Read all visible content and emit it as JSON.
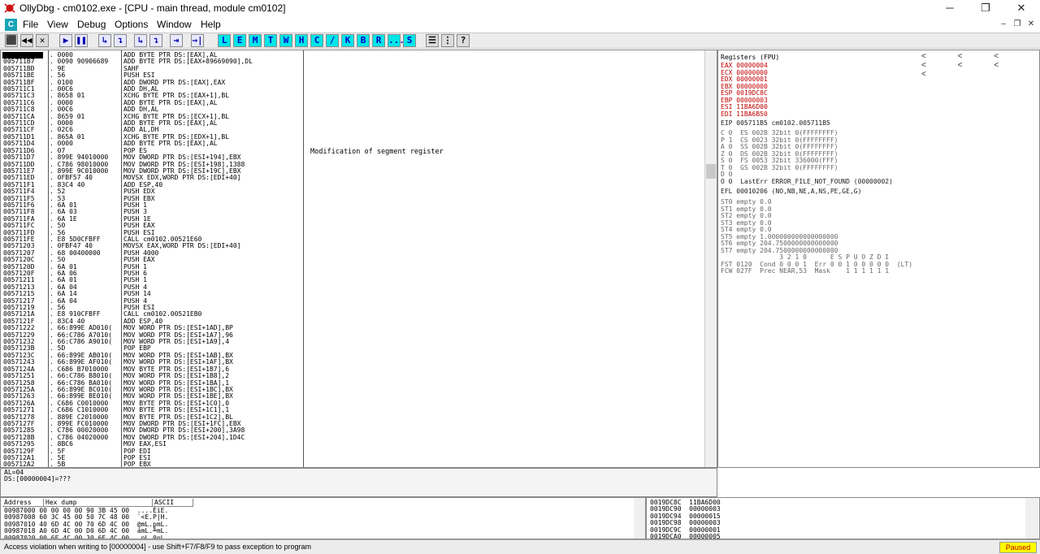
{
  "window": {
    "title": "OllyDbg - cm0102.exe - [CPU - main thread, module cm0102]",
    "controls": [
      "─",
      "❐",
      "✕"
    ]
  },
  "menu": {
    "sys_icon": "C",
    "items": [
      "File",
      "View",
      "Debug",
      "Options",
      "Window",
      "Help"
    ]
  },
  "toolbar": {
    "run_buttons": [
      "⬛",
      "◀◀",
      "✕",
      "▶",
      "❚❚",
      "↳",
      "↴",
      "↳",
      "↴",
      "⇥",
      "→|"
    ],
    "window_buttons": [
      "L",
      "E",
      "M",
      "T",
      "W",
      "H",
      "C",
      "/",
      "K",
      "B",
      "R",
      "...",
      "S"
    ],
    "extra_buttons": [
      "☰",
      "⋮",
      "?"
    ]
  },
  "disasm": {
    "addresses": "005711B5\n005711B7\n005711BD\n005711BE\n005711BF\n005711C1\n005711C3\n005711C6\n005711C8\n005711CA\n005711CD\n005711CF\n005711D1\n005711D4\n005711D6\n005711D7\n005711DD\n005711E7\n005711ED\n005711F1\n005711F4\n005711F5\n005711F6\n005711F8\n005711FA\n005711FC\n005711FD\n005711FE\n00571203\n00571207\n0057120C\n0057120D\n0057120F\n00571211\n00571213\n00571215\n00571217\n00571219\n0057121A\n0057121F\n00571222\n00571229\n00571232\n0057123B\n0057123C\n00571243\n0057124A\n00571251\n00571258\n0057125A\n00571263\n0057126A\n00571271\n00571278\n0057127F\n00571285\n0057128B\n00571295\n0057129F\n005712A1\n005712A2\n005712A3",
    "hex": ". 0000\n. 0090 90906689\n. 9E\n. 56\n. 0100\n. 00C6\n. 8658 01\n. 0000\n. 00C6\n. 8659 01\n. 0000\n. 02C6\n. 865A 01\n. 0000\n. 07\n. 899E 94010000\n. C786 98010000\n. 899E 9C010000\n. 0FBF57 40\n. 83C4 40\n. 52\n. 53\n. 6A 01\n. 6A 03\n. 6A 1E\n. 50\n. 56\n. E8 5D0CFBFF\n. 0FBF47 40\n. 68 00400000\n. 50\n. 6A 01\n. 6A 06\n. 6A 01\n. 6A 04\n. 6A 14\n. 6A 04\n. 56\n. E8 910CFBFF\n. 83C4 40\n. 66:899E AD010(\n. 66:C786 A7010(\n. 66:C786 A9010(\n. 5D\n. 66:899E AB010(\n. 66:899E AF010(\n. C686 B7010000\n. 66:C786 B8010(\n. 66:C786 BA010(\n. 66:899E BC010(\n. 66:899E BE010(\n. C686 C0010000\n. C686 C1010000\n. 889E C2010000\n. 899E FC010000\n. C786 00020000\n. C786 04020000\n. 8BC6\n. 5F\n. 5E\n. 5B",
    "instructions": "ADD BYTE PTR DS:[EAX],AL\nADD BYTE PTR DS:[EAX+89669090],DL\nSAHF\nPUSH ESI\nADD DWORD PTR DS:[EAX],EAX\nADD DH,AL\nXCHG BYTE PTR DS:[EAX+1],BL\nADD BYTE PTR DS:[EAX],AL\nADD DH,AL\nXCHG BYTE PTR DS:[ECX+1],BL\nADD BYTE PTR DS:[EAX],AL\nADD AL,DH\nXCHG BYTE PTR DS:[EDX+1],BL\nADD BYTE PTR DS:[EAX],AL\nPOP ES\nMOV DWORD PTR DS:[ESI+194],EBX\nMOV DWORD PTR DS:[ESI+198],1388\nMOV DWORD PTR DS:[ESI+19C],EBX\nMOVSX EDX,WORD PTR DS:[EDI+40]\nADD ESP,40\nPUSH EDX\nPUSH EBX\nPUSH 1\nPUSH 3\nPUSH 1E\nPUSH EAX\nPUSH ESI\nCALL cm0102.00521E60\nMOVSX EAX,WORD PTR DS:[EDI+40]\nPUSH 4000\nPUSH EAX\nPUSH 1\nPUSH 6\nPUSH 1\nPUSH 4\nPUSH 14\nPUSH 4\nPUSH ESI\nCALL cm0102.00521EB0\nADD ESP,40\nMOV WORD PTR DS:[ESI+1AD],BP\nMOV WORD PTR DS:[ESI+1A7],96\nMOV WORD PTR DS:[ESI+1A9],4\nPOP EBP\nMOV WORD PTR DS:[ESI+1AB],BX\nMOV WORD PTR DS:[ESI+1AF],BX\nMOV BYTE PTR DS:[ESI+1B7],6\nMOV WORD PTR DS:[ESI+1B8],2\nMOV WORD PTR DS:[ESI+1BA],1\nMOV WORD PTR DS:[ESI+1BC],BX\nMOV WORD PTR DS:[ESI+1BE],BX\nMOV BYTE PTR DS:[ESI+1C0],0\nMOV BYTE PTR DS:[ESI+1C1],1\nMOV BYTE PTR DS:[ESI+1C2],BL\nMOV DWORD PTR DS:[ESI+1FC],EBX\nMOV DWORD PTR DS:[ESI+200],3A98\nMOV DWORD PTR DS:[ESI+204],1D4C\nMOV EAX,ESI\nPOP EDI\nPOP ESI\nPOP EBX",
    "comment": "Modification of segment register"
  },
  "registers": {
    "header": "Registers (FPU)",
    "arrows": "< < < < < < <",
    "general": "EAX 00000004\nECX 00000000\nEDX 00000001\nEBX 00000000\nESP 0019DC8C\nEBP 00000003\nESI 11BA6D00\nEDI 11BA6B50",
    "eip": "EIP 005711B5 cm0102.005711B5",
    "flags": "C 0  ES 002B 32bit 0(FFFFFFFF)\nP 1  CS 0023 32bit 0(FFFFFFFF)\nA 0  SS 002B 32bit 0(FFFFFFFF)\nZ 0  DS 002B 32bit 0(FFFFFFFF)\nS 0  FS 0053 32bit 336000(FFF)\nT 0  GS 002B 32bit 0(FFFFFFFF)\nD 0",
    "lasterr": "O 0  LastErr ERROR_FILE_NOT_FOUND (00000002)",
    "efl": "EFL 00010206 (NO,NB,NE,A,NS,PE,GE,G)",
    "fpu": "ST0 empty 0.0\nST1 empty 0.0\nST2 empty 0.0\nST3 empty 0.0\nST4 empty 0.0\nST5 empty 1.000000000000000000\nST6 empty 204.7500000000000000\nST7 empty 204.7500000000000000",
    "fst": "               3 2 1 0      E S P U O Z D I\nFST 0120  Cond 0 0 0 1  Err 0 0 1 0 0 0 0 0  (LT)\nFCW 027F  Prec NEAR,53  Mask    1 1 1 1 1 1"
  },
  "info": "AL=04\nDS:[00000004]=???",
  "dump": {
    "headers": [
      "Address",
      "Hex dump",
      "ASCII"
    ],
    "rows": "00987000 00 00 00 00 90 3B 45 00  ....ÉiE.\n00987008 60 3C 45 00 50 7C 48 00  `<E.P|H.\n00987010 40 6D 4C 00 70 6D 4C 00  @mL.pmL.\n00987018 A0 6D 4C 00 D0 6D 4C 00  ámL.╨mL.\n00987020 00 6E 4C 00 30 6E 4C 00  .nL.0nL."
  },
  "stack": {
    "rows": "0019DC8C  11BA6D00\n0019DC90  00000003\n0019DC94  00000015\n0019DC98  00000003\n0019DC9C  00000001\n0019DCA0  00000005"
  },
  "status": {
    "message": "Access violation when writing to [00000004] - use Shift+F7/F8/F9 to pass exception to program",
    "state": "Paused"
  }
}
